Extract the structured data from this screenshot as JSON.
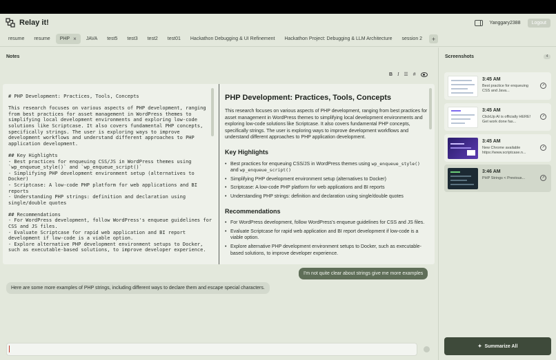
{
  "header": {
    "app_title": "Relay it!",
    "username": "Yanggary2388",
    "logout_label": "Logout"
  },
  "tabs": [
    {
      "label": "resume"
    },
    {
      "label": "resume"
    },
    {
      "label": "PHP",
      "active": true
    },
    {
      "label": "JAVA"
    },
    {
      "label": "test5"
    },
    {
      "label": "test3"
    },
    {
      "label": "test2"
    },
    {
      "label": "test01"
    },
    {
      "label": "Hackathon Debugging & UI Refinement"
    },
    {
      "label": "Hackathon Project: Debugging & LLM Architecture"
    },
    {
      "label": "session 2"
    }
  ],
  "notes": {
    "title": "Notes",
    "toolbar": {
      "bold": "B",
      "italic": "I",
      "list": "☰",
      "heading": "#"
    },
    "source": "# PHP Development: Practices, Tools, Concepts\n\nThis research focuses on various aspects of PHP development, ranging from best practices for asset management in WordPress themes to simplifying local development environments and exploring low-code solutions like Scriptcase. It also covers fundamental PHP concepts, specifically strings. The user is exploring ways to improve development workflows and understand different approaches to PHP application development.\n\n## Key Highlights\n- Best practices for enqueuing CSS/JS in WordPress themes using `wp_enqueue_style()` and `wp_enqueue_script()`\n- Simplifying PHP development environment setup (alternatives to Docker)\n- Scriptcase: A low-code PHP platform for web applications and BI reports\n- Understanding PHP strings: definition and declaration using single/double quotes\n\n## Recommendations\n- For WordPress development, follow WordPress's enqueue guidelines for CSS and JS files.\n- Evaluate Scriptcase for rapid web application and BI report development if low-code is a viable option.\n- Explore alternative PHP development environment setups to Docker, such as executable-based solutions, to improve developer experience.",
    "preview": {
      "h1": "PHP Development: Practices, Tools, Concepts",
      "intro": "This research focuses on various aspects of PHP development, ranging from best practices for asset management in WordPress themes to simplifying local development environments and exploring low-code solutions like Scriptcase. It also covers fundamental PHP concepts, specifically strings. The user is exploring ways to improve development workflows and understand different approaches to PHP application development.",
      "h2_highlights": "Key Highlights",
      "hl1_pre": "Best practices for enqueuing CSS/JS in WordPress themes using ",
      "hl1_code1": "wp_enqueue_style()",
      "hl1_mid": " and ",
      "hl1_code2": "wp_enqueue_script()",
      "hl2": "Simplifying PHP development environment setup (alternatives to Docker)",
      "hl3": "Scriptcase: A low-code PHP platform for web applications and BI reports",
      "hl4": "Understanding PHP strings: definition and declaration using single/double quotes",
      "h2_recs": "Recommendations",
      "rec1": "For WordPress development, follow WordPress's enqueue guidelines for CSS and JS files.",
      "rec2": "Evaluate Scriptcase for rapid web application and BI report development if low-code is a viable option.",
      "rec3": "Explore alternative PHP development environment setups to Docker, such as executable-based solutions, to improve developer experience."
    }
  },
  "chat": {
    "user_message": "I'm not quite clear about strings give me more examples",
    "bot_message": "Here are some more examples of PHP strings, including different ways to declare them and escape special characters.",
    "input_value": ""
  },
  "sidebar": {
    "title": "Screenshots",
    "count": "4",
    "screenshots": [
      {
        "time": "3:45 AM",
        "desc": "Best practice for enqueuing CSS and Java...",
        "thumb": "light"
      },
      {
        "time": "3:45 AM",
        "desc": "ClickUp AI is officially HERE! Get work done fas...",
        "thumb": "light"
      },
      {
        "time": "3:45 AM",
        "desc": "New Chrome available https://www.scriptcase.n...",
        "thumb": "purple"
      },
      {
        "time": "3:46 AM",
        "desc": "PHP Strings < Previous...",
        "thumb": "code"
      }
    ],
    "summarize_label": "Summarize All"
  },
  "colors": {
    "background": "#e3e8dc",
    "user_bubble": "#5f6e58",
    "summarize_button": "#3e4a3a"
  }
}
